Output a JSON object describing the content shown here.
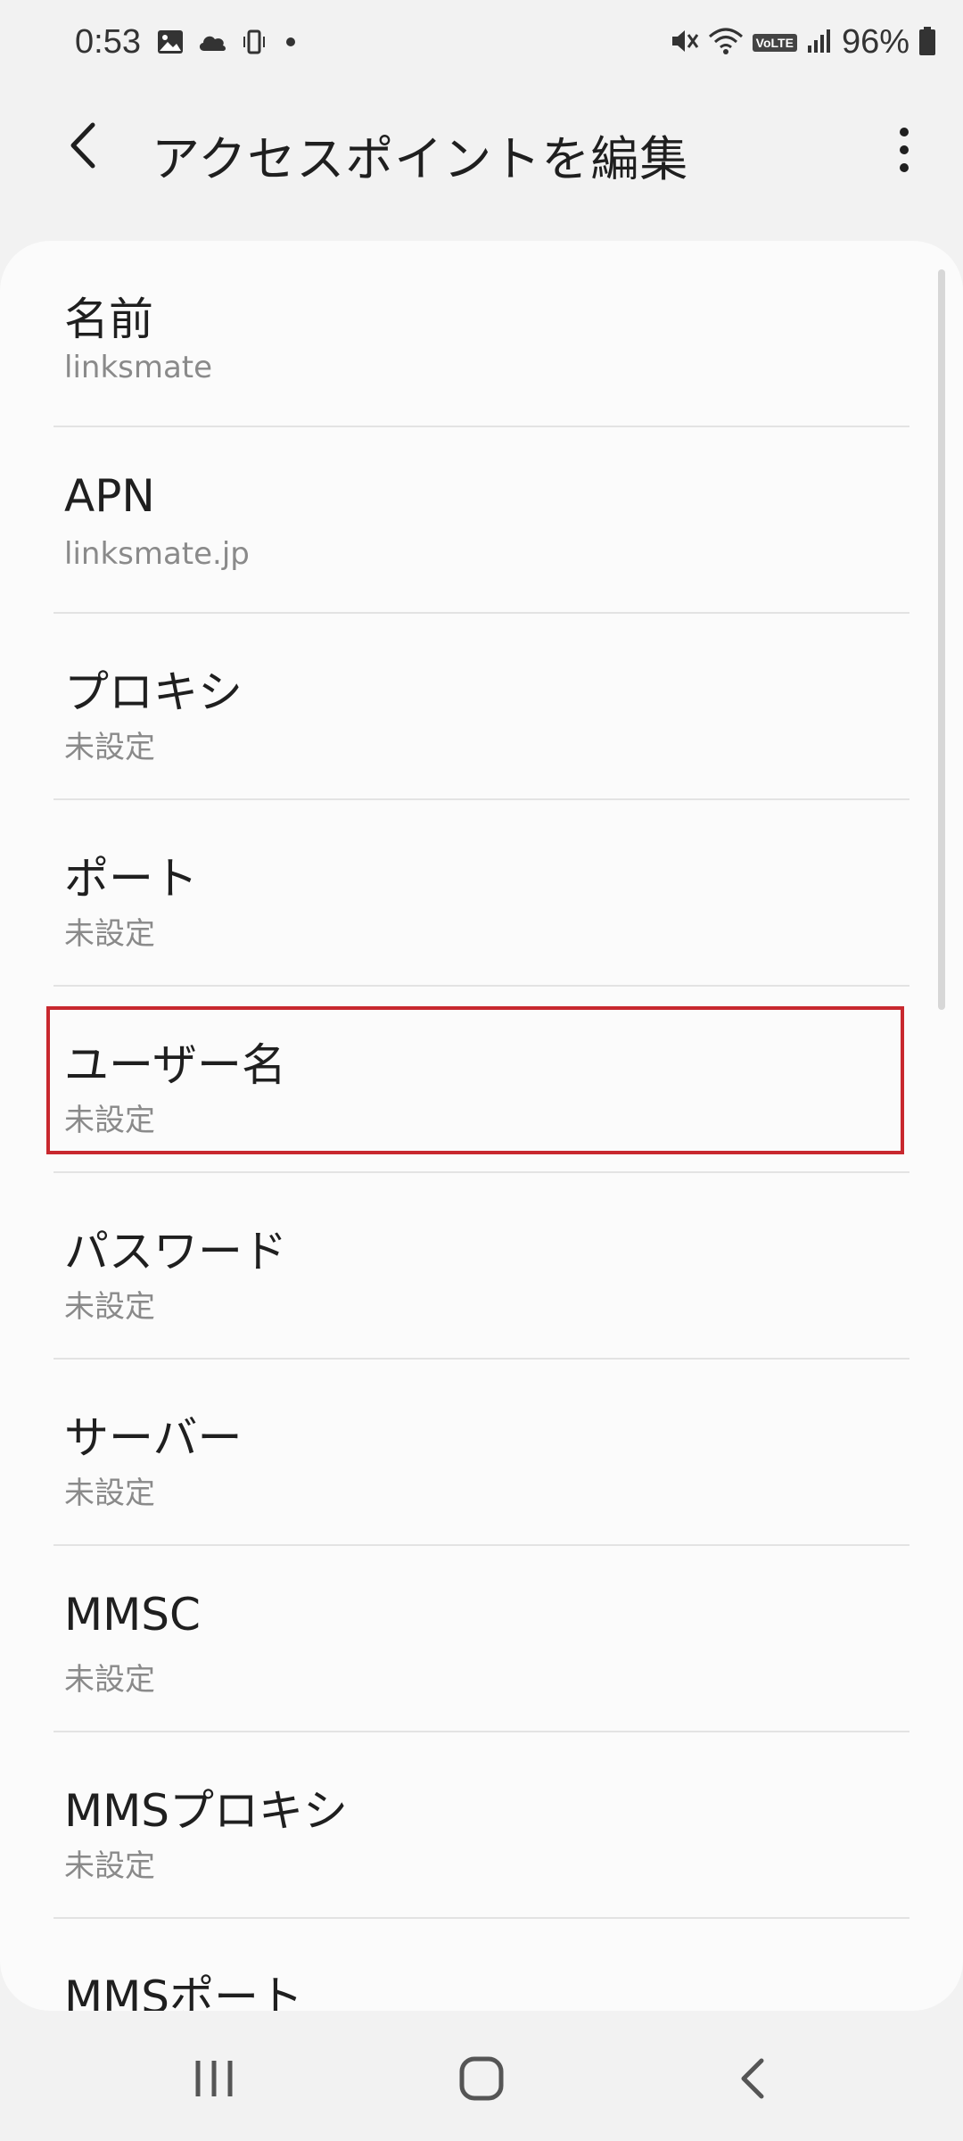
{
  "status_bar": {
    "time": "0:53",
    "battery_text": "96%",
    "network_badge": "VoLTE",
    "icons": [
      "image-icon",
      "cloud-icon",
      "phone-vibrate-icon",
      "dot-icon",
      "mute-icon",
      "wifi-icon",
      "signal-icon",
      "battery-icon"
    ]
  },
  "app_bar": {
    "title": "アクセスポイントを編集",
    "back_icon": "back-arrow-icon",
    "more_icon": "more-vert-icon"
  },
  "settings": [
    {
      "title": "名前",
      "value": "linksmate"
    },
    {
      "title": "APN",
      "value": "linksmate.jp"
    },
    {
      "title": "プロキシ",
      "value": "未設定"
    },
    {
      "title": "ポート",
      "value": "未設定"
    },
    {
      "title": "ユーザー名",
      "value": "未設定",
      "highlighted": true
    },
    {
      "title": "パスワード",
      "value": "未設定"
    },
    {
      "title": "サーバー",
      "value": "未設定"
    },
    {
      "title": "MMSC",
      "value": "未設定"
    },
    {
      "title": "MMSプロキシ",
      "value": "未設定"
    },
    {
      "title": "MMSポート",
      "value": ""
    }
  ],
  "highlight_color": "#c8282e",
  "nav_bar": {
    "icons": [
      "recent-apps-icon",
      "home-icon",
      "nav-back-icon"
    ]
  }
}
